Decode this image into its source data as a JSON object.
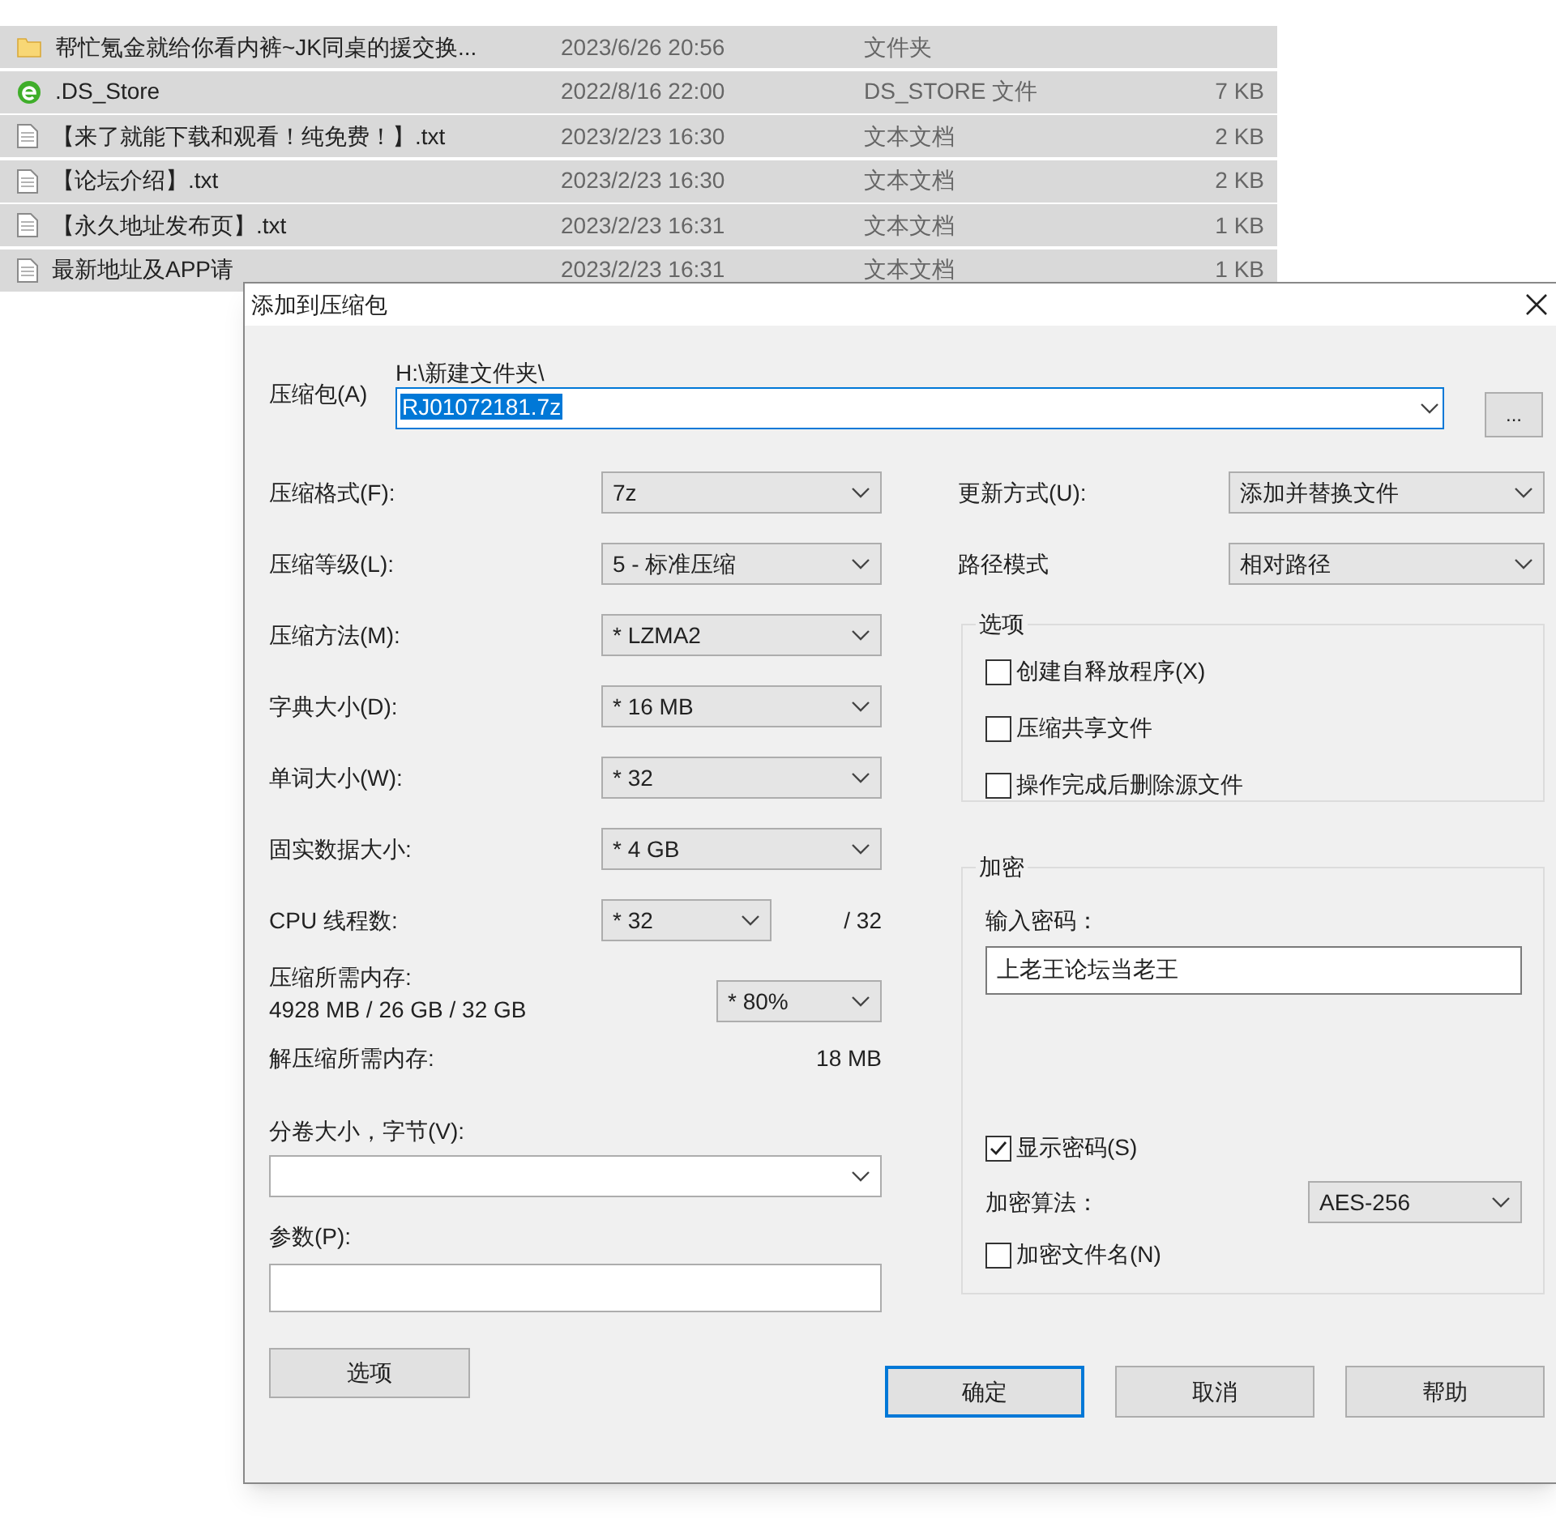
{
  "explorer": {
    "rows": [
      {
        "kind": "folder",
        "name": "帮忙氪金就给你看内裤~JK同桌的援交换...",
        "date": "2023/6/26 20:56",
        "type": "文件夹",
        "selected": true
      },
      {
        "kind": "app",
        "name": ".DS_Store",
        "date": "2022/8/16 22:00",
        "type": "DS_STORE 文件",
        "size": "7 KB",
        "selected": true
      },
      {
        "kind": "text",
        "name": "【来了就能下载和观看！纯免费！】.txt",
        "date": "2023/2/23 16:30",
        "type": "文本文档",
        "size": "2 KB",
        "selected": true
      },
      {
        "kind": "text",
        "name": "【论坛介绍】.txt",
        "date": "2023/2/23 16:30",
        "type": "文本文档",
        "size": "2 KB",
        "selected": true
      },
      {
        "kind": "text",
        "name": "【永久地址发布页】.txt",
        "date": "2023/2/23 16:31",
        "type": "文本文档",
        "size": "1 KB",
        "selected": true
      },
      {
        "kind": "text",
        "name": "最新地址及APP请",
        "date": "2023/2/23 16:31",
        "type": "文本文档",
        "size": "1 KB",
        "selected": true
      }
    ]
  },
  "dialog": {
    "title": "添加到压缩包",
    "archive": {
      "label": "压缩包(A)",
      "path": "H:\\新建文件夹\\",
      "value": "RJ01072181.7z",
      "text_selected": true
    },
    "browse_button": "...",
    "left_fields": [
      {
        "kind": "combo",
        "label": "压缩格式(F):",
        "value": "7z"
      },
      {
        "kind": "combo",
        "label": "压缩等级(L):",
        "value": "5 - 标准压缩"
      },
      {
        "kind": "combo",
        "label": "压缩方法(M):",
        "value": "* LZMA2"
      },
      {
        "kind": "combo",
        "label": "字典大小(D):",
        "value": "* 16 MB"
      },
      {
        "kind": "combo",
        "label": "单词大小(W):",
        "value": "* 32"
      },
      {
        "kind": "combo",
        "label": "固实数据大小:",
        "value": "* 4 GB"
      },
      {
        "kind": "threads",
        "label": "CPU 线程数:",
        "value": "* 32",
        "note": "/ 32"
      },
      {
        "kind": "memory",
        "label": "压缩所需内存:",
        "detail": "4928 MB / 26 GB / 32 GB",
        "value": "* 80%"
      },
      {
        "kind": "info",
        "label": "解压缩所需内存:",
        "note": "18 MB"
      }
    ],
    "volume": {
      "label": "分卷大小，字节(V):"
    },
    "parameters": {
      "label": "参数(P):"
    },
    "options_button": "选项",
    "update_mode": {
      "label": "更新方式(U):",
      "value": "添加并替换文件"
    },
    "path_mode": {
      "label": "路径模式",
      "value": "相对路径"
    },
    "options": {
      "title": "选项",
      "checkboxes": [
        {
          "label": "创建自释放程序(X)",
          "checked": false
        },
        {
          "label": "压缩共享文件",
          "checked": false
        },
        {
          "label": "操作完成后删除源文件",
          "checked": false
        }
      ]
    },
    "encryption": {
      "title": "加密",
      "password_label": "输入密码：",
      "password": "上老王论坛当老王",
      "show_password": {
        "label": "显示密码(S)",
        "checked": true
      },
      "method_label": "加密算法：",
      "method": "AES-256",
      "encrypt_names": {
        "label": "加密文件名(N)",
        "checked": false
      }
    },
    "buttons": [
      {
        "label": "确定",
        "default": true
      },
      {
        "label": "取消",
        "default": false
      },
      {
        "label": "帮助",
        "default": false
      }
    ]
  }
}
